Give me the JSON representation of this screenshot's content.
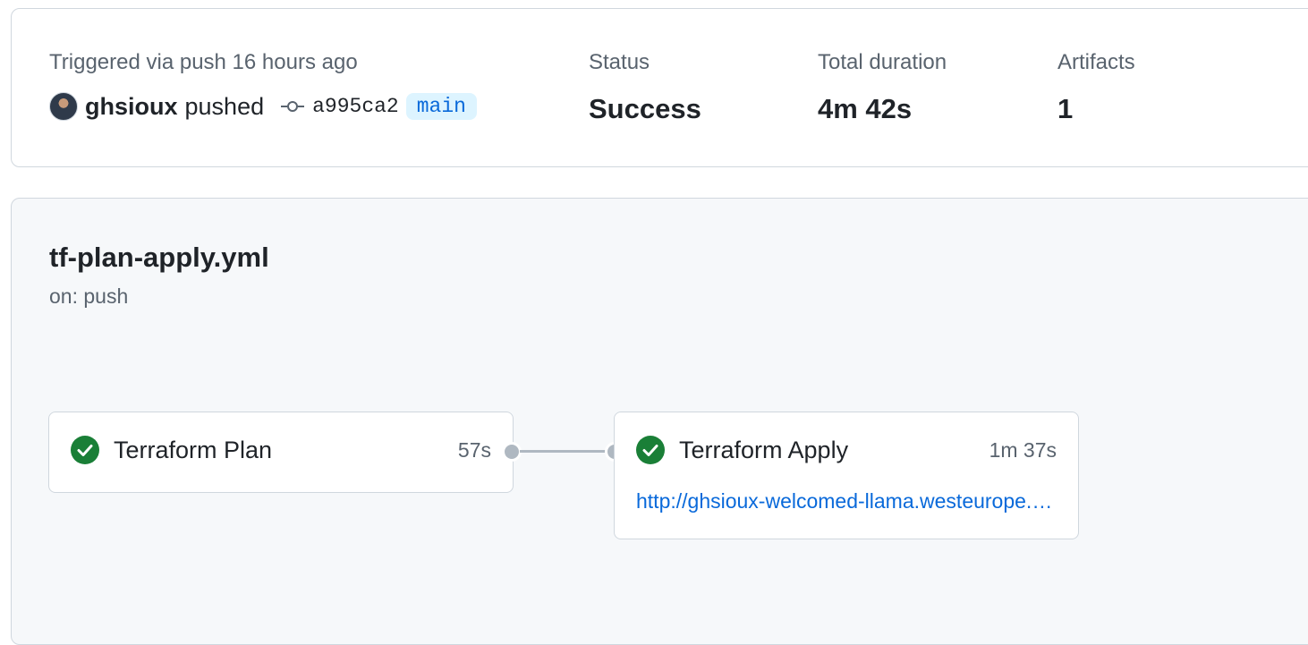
{
  "summary": {
    "trigger_text": "Triggered via push 16 hours ago",
    "actor": "ghsioux",
    "action": "pushed",
    "commit_sha": "a995ca2",
    "branch": "main",
    "status_label": "Status",
    "status_value": "Success",
    "duration_label": "Total duration",
    "duration_value": "4m 42s",
    "artifacts_label": "Artifacts",
    "artifacts_value": "1"
  },
  "workflow": {
    "file": "tf-plan-apply.yml",
    "trigger": "on: push",
    "jobs": [
      {
        "name": "Terraform Plan",
        "duration": "57s",
        "status": "success"
      },
      {
        "name": "Terraform Apply",
        "duration": "1m 37s",
        "status": "success",
        "url": "http://ghsioux-welcomed-llama.westeurope.azurecontainer.io"
      }
    ]
  },
  "colors": {
    "success": "#1a7f37",
    "link": "#0969da",
    "branch_bg": "#ddf4ff",
    "muted": "#59636e",
    "border": "#d0d7de"
  },
  "icons": {
    "commit": "git-commit-icon",
    "check": "check-circle-fill-icon",
    "avatar": "user-avatar"
  }
}
